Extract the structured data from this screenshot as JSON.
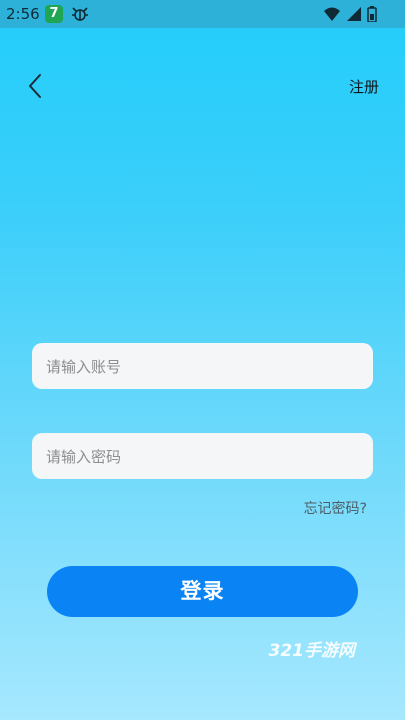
{
  "status_bar": {
    "time": "2:56",
    "app_badge": "7",
    "icons": [
      "wifi-icon",
      "signal-icon",
      "battery-icon"
    ]
  },
  "header": {
    "back_icon": "chevron-left-icon",
    "register_label": "注册"
  },
  "form": {
    "account_placeholder": "请输入账号",
    "account_value": "",
    "password_placeholder": "请输入密码",
    "password_value": "",
    "forgot_label": "忘记密码?",
    "login_label": "登录"
  },
  "watermark": "321手游网",
  "colors": {
    "login_button": "#0a84f5",
    "background_top": "#22cdfb",
    "background_bottom": "#a6e8fe"
  }
}
